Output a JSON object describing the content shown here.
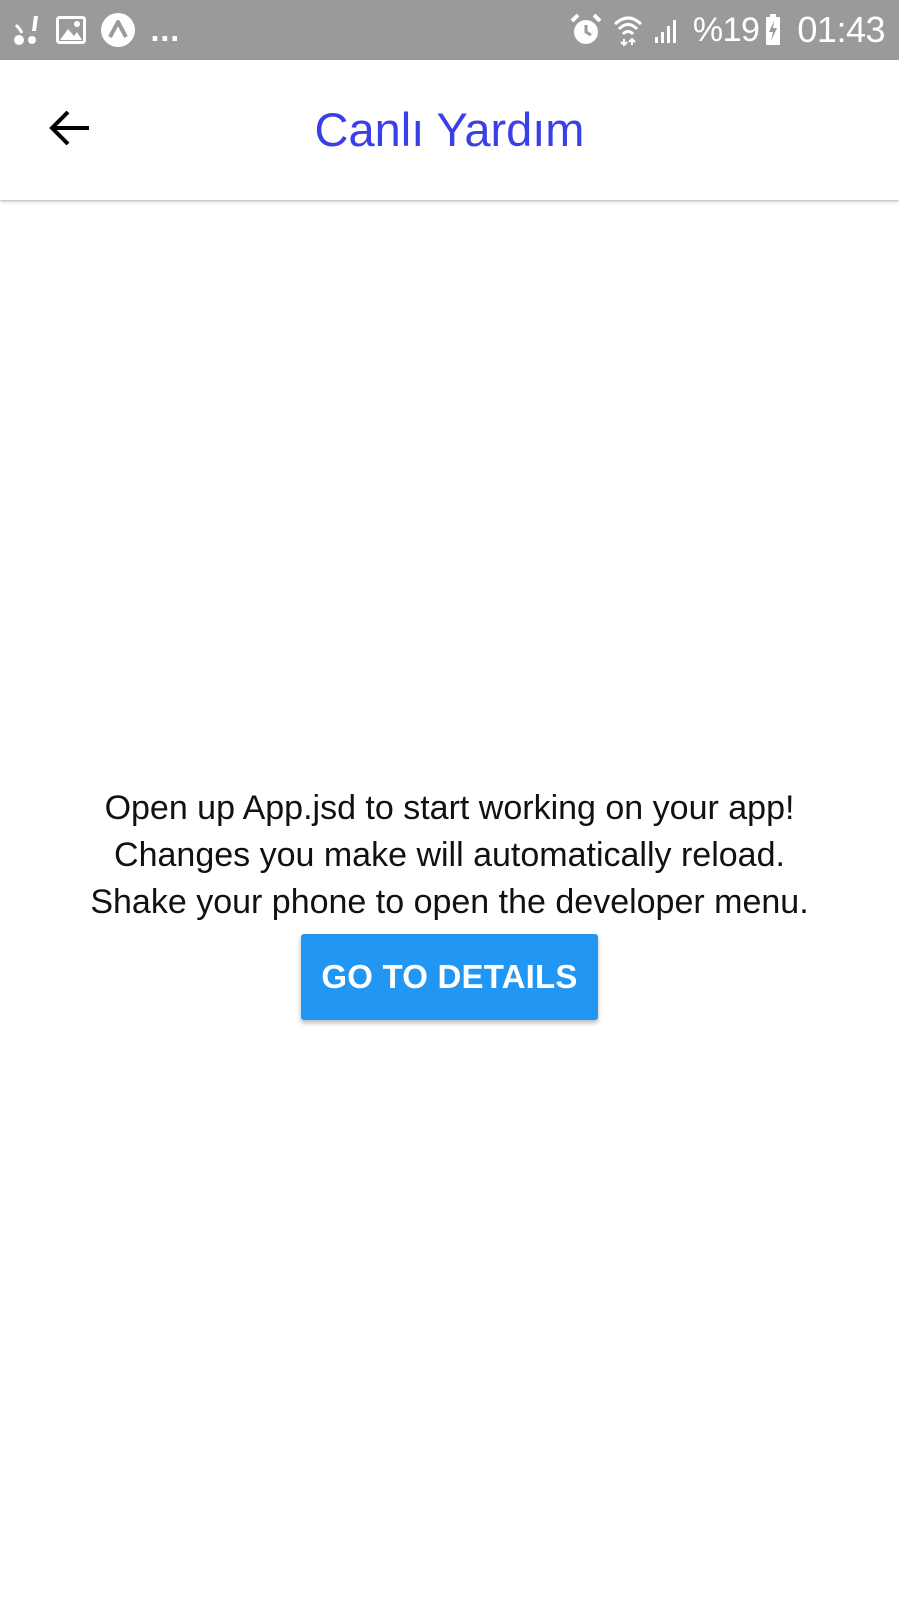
{
  "status_bar": {
    "left_icons": [
      "call-forward-icon",
      "image-icon",
      "app-a-icon"
    ],
    "more_indicator": "...",
    "right_icons": [
      "alarm-icon",
      "wifi-icon",
      "signal-icon",
      "battery-charging-icon"
    ],
    "battery_percent": "%19",
    "time": "01:43",
    "background_color": "#9a9a9a"
  },
  "header": {
    "back_icon": "arrow-left-icon",
    "title": "Canlı Yardım",
    "title_color": "#3a3fe8"
  },
  "content": {
    "lines": [
      "Open up App.jsd to start working on your app!",
      "Changes you make will automatically reload.",
      "Shake your phone to open the developer menu."
    ],
    "button_label": "GO TO DETAILS",
    "button_color": "#2196f3"
  }
}
